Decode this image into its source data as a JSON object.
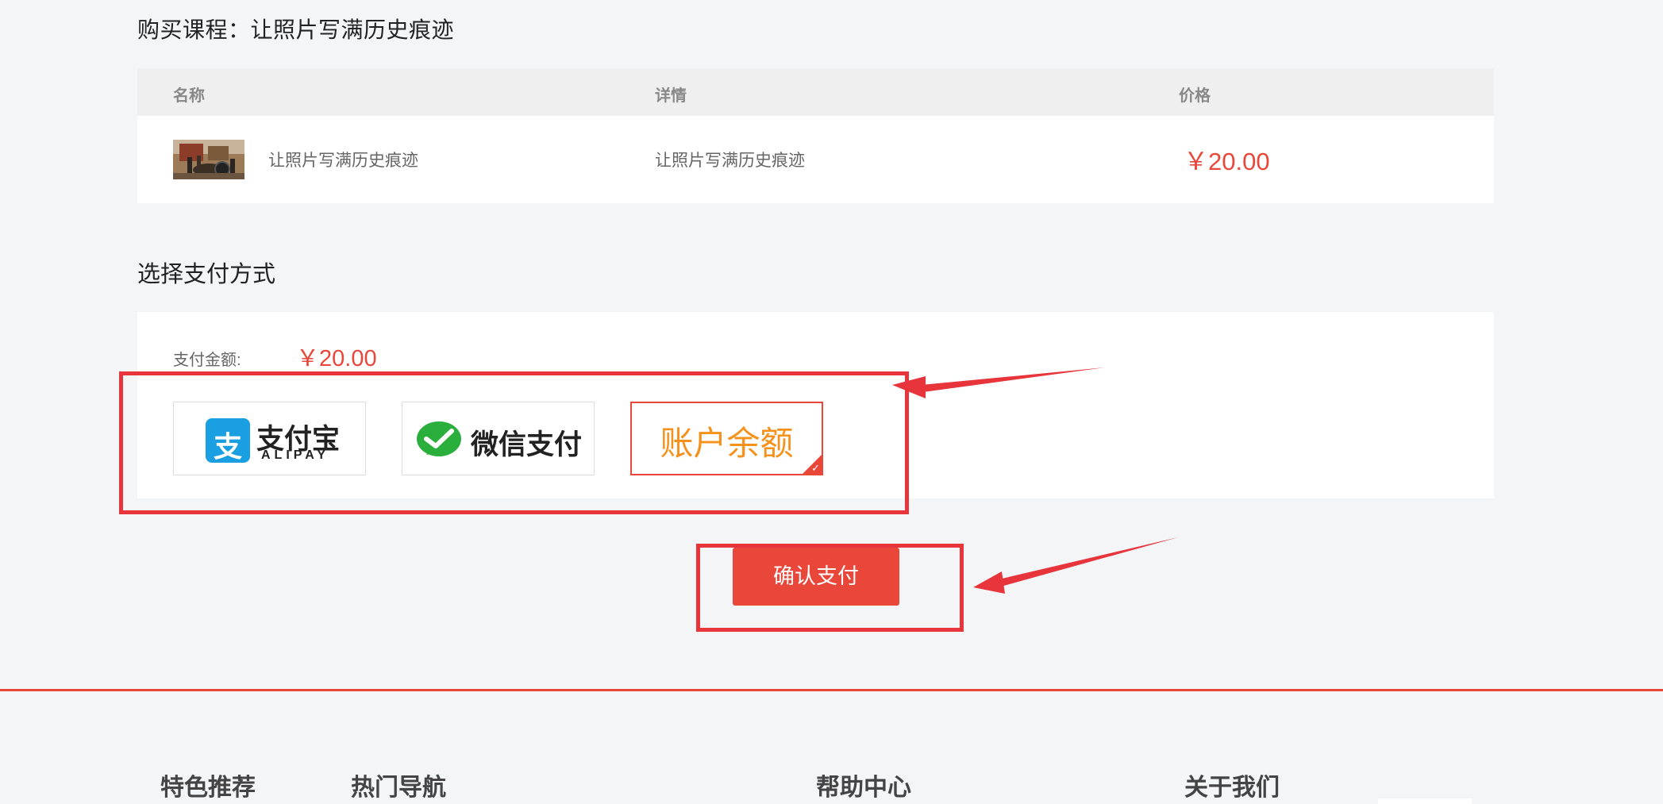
{
  "header": {
    "title": "购买课程：让照片写满历史痕迹"
  },
  "order_table": {
    "columns": {
      "name": "名称",
      "detail": "详情",
      "price": "价格"
    },
    "row": {
      "thumbnail_icon": "course-thumbnail-image",
      "name": "让照片写满历史痕迹",
      "detail": "让照片写满历史痕迹",
      "price": "￥20.00"
    }
  },
  "payment": {
    "heading": "选择支付方式",
    "amount_label": "支付金额:",
    "amount_value": "￥20.00",
    "methods": {
      "alipay": {
        "icon": "alipay-logo-icon",
        "logo_char": "支",
        "label_cn": "支付宝",
        "label_en": "ALIPAY"
      },
      "wechat": {
        "icon": "wechat-logo-icon",
        "label_cn": "微信支付"
      },
      "balance": {
        "label": "账户余额",
        "selected": true
      }
    },
    "confirm_label": "确认支付"
  },
  "footer": {
    "columns": [
      "特色推荐",
      "热门导航",
      "帮助中心",
      "关于我们"
    ]
  },
  "colors": {
    "accent": "#e8473a",
    "annotation": "#e8353c",
    "alipay_blue": "#1a9fe3",
    "wechat_green": "#2aae3c",
    "balance_orange": "#f5921e"
  }
}
